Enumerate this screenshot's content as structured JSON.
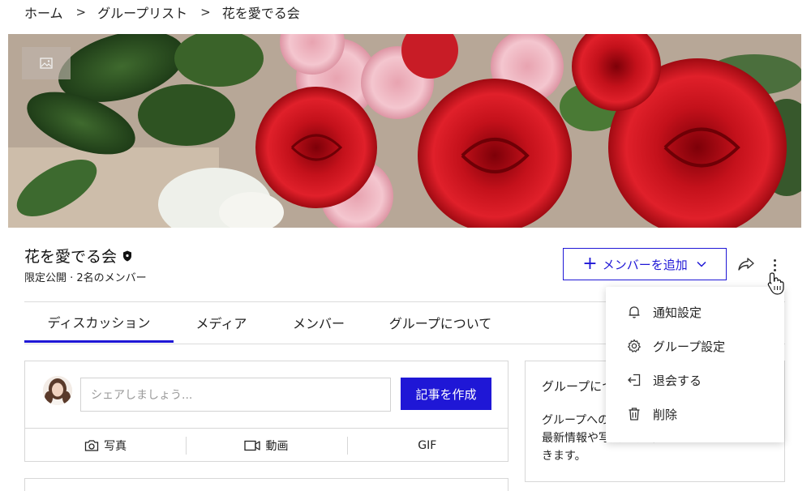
{
  "breadcrumb": {
    "items": [
      "ホーム",
      "グループリスト",
      "花を愛でる会"
    ],
    "separator": ">"
  },
  "group": {
    "name": "花を愛でる会",
    "meta": "限定公開 · 2名のメンバー"
  },
  "actions": {
    "add_member_label": "メンバーを追加",
    "add_member_plus": "+"
  },
  "tabs": [
    {
      "label": "ディスカッション",
      "active": true
    },
    {
      "label": "メディア",
      "active": false
    },
    {
      "label": "メンバー",
      "active": false
    },
    {
      "label": "グループについて",
      "active": false
    }
  ],
  "composer": {
    "placeholder": "シェアしましょう...",
    "create_label": "記事を作成",
    "media": [
      {
        "label": "写真",
        "icon": "camera-icon"
      },
      {
        "label": "動画",
        "icon": "video-icon"
      },
      {
        "label": "GIF",
        "icon": ""
      }
    ]
  },
  "about": {
    "title": "グループについて",
    "body": "グループへの参加者は、ここで交流したり、最新情報や写真、動画をシェアすることができます。"
  },
  "menu": {
    "items": [
      {
        "label": "通知設定",
        "icon": "bell-icon"
      },
      {
        "label": "グループ設定",
        "icon": "gear-icon"
      },
      {
        "label": "退会する",
        "icon": "leave-icon"
      },
      {
        "label": "削除",
        "icon": "trash-icon"
      }
    ]
  },
  "colors": {
    "accent": "#1f17d6",
    "border": "#d7d7d7",
    "text": "#222222"
  }
}
